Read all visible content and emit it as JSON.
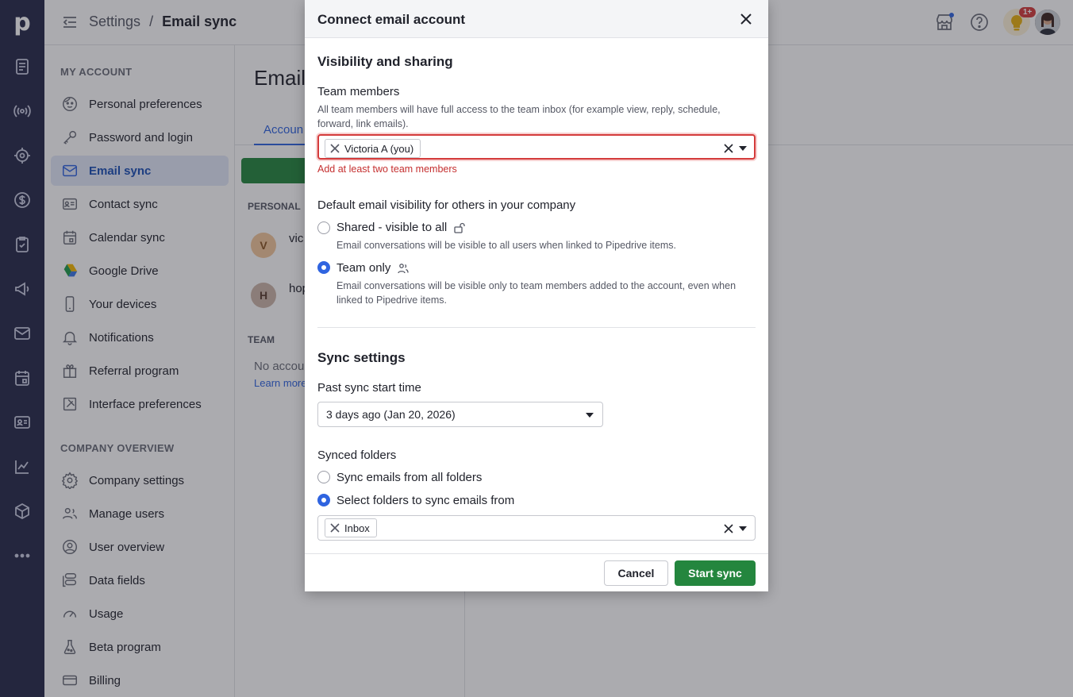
{
  "app": {
    "logo": "p"
  },
  "header": {
    "breadcrumb_parent": "Settings",
    "breadcrumb_sep": "/",
    "breadcrumb_current": "Email sync",
    "notification_badge": "1+"
  },
  "sidebar": {
    "my_account_label": "MY ACCOUNT",
    "company_overview_label": "COMPANY OVERVIEW",
    "items": [
      {
        "label": "Personal preferences",
        "icon": "face-icon"
      },
      {
        "label": "Password and login",
        "icon": "key-icon"
      },
      {
        "label": "Email sync",
        "icon": "mail-icon"
      },
      {
        "label": "Contact sync",
        "icon": "contact-card-icon"
      },
      {
        "label": "Calendar sync",
        "icon": "calendar-icon"
      },
      {
        "label": "Google Drive",
        "icon": "google-drive-icon"
      },
      {
        "label": "Your devices",
        "icon": "phone-icon"
      },
      {
        "label": "Notifications",
        "icon": "bell-icon"
      },
      {
        "label": "Referral program",
        "icon": "gift-icon"
      },
      {
        "label": "Interface preferences",
        "icon": "interface-icon"
      }
    ],
    "company_items": [
      {
        "label": "Company settings",
        "icon": "gear-icon"
      },
      {
        "label": "Manage users",
        "icon": "users-icon"
      },
      {
        "label": "User overview",
        "icon": "user-circle-icon"
      },
      {
        "label": "Data fields",
        "icon": "data-fields-icon"
      },
      {
        "label": "Usage",
        "icon": "gauge-icon"
      },
      {
        "label": "Beta program",
        "icon": "flask-icon"
      },
      {
        "label": "Billing",
        "icon": "credit-card-icon"
      }
    ]
  },
  "main": {
    "page_title": "Email",
    "tab_label": "Accoun",
    "personal_label": "PERSONAL",
    "team_label": "TEAM",
    "accounts": [
      {
        "initial": "V",
        "name": "vic"
      },
      {
        "initial": "H",
        "name": "hop"
      }
    ],
    "no_accounts": "No accou",
    "learn_more": "Learn more"
  },
  "modal": {
    "title": "Connect email account",
    "visibility_heading": "Visibility and sharing",
    "team_members_label": "Team members",
    "team_members_help": "All team members will have full access to the team inbox (for example view, reply, schedule, forward, link emails).",
    "team_member_chip": "Victoria A (you)",
    "team_members_error": "Add at least two team members",
    "default_visibility_label": "Default email visibility for others in your company",
    "option_shared_label": "Shared - visible to all",
    "option_shared_help": "Email conversations will be visible to all users when linked to Pipedrive items.",
    "option_team_label": "Team only",
    "option_team_help": "Email conversations will be visible only to team members added to the account, even when linked to Pipedrive items.",
    "selected_visibility": "team",
    "sync_heading": "Sync settings",
    "past_sync_label": "Past sync start time",
    "past_sync_value": "3 days ago (Jan 20, 2026)",
    "synced_folders_label": "Synced folders",
    "folders_all_label": "Sync emails from all folders",
    "folders_select_label": "Select folders to sync emails from",
    "selected_folders_option": "select",
    "folder_chip": "Inbox",
    "cancel_label": "Cancel",
    "start_label": "Start sync"
  },
  "colors": {
    "rail_bg": "#26294a",
    "accent": "#2f64e0",
    "primary_green": "#24863e",
    "error": "#d43b3b"
  }
}
